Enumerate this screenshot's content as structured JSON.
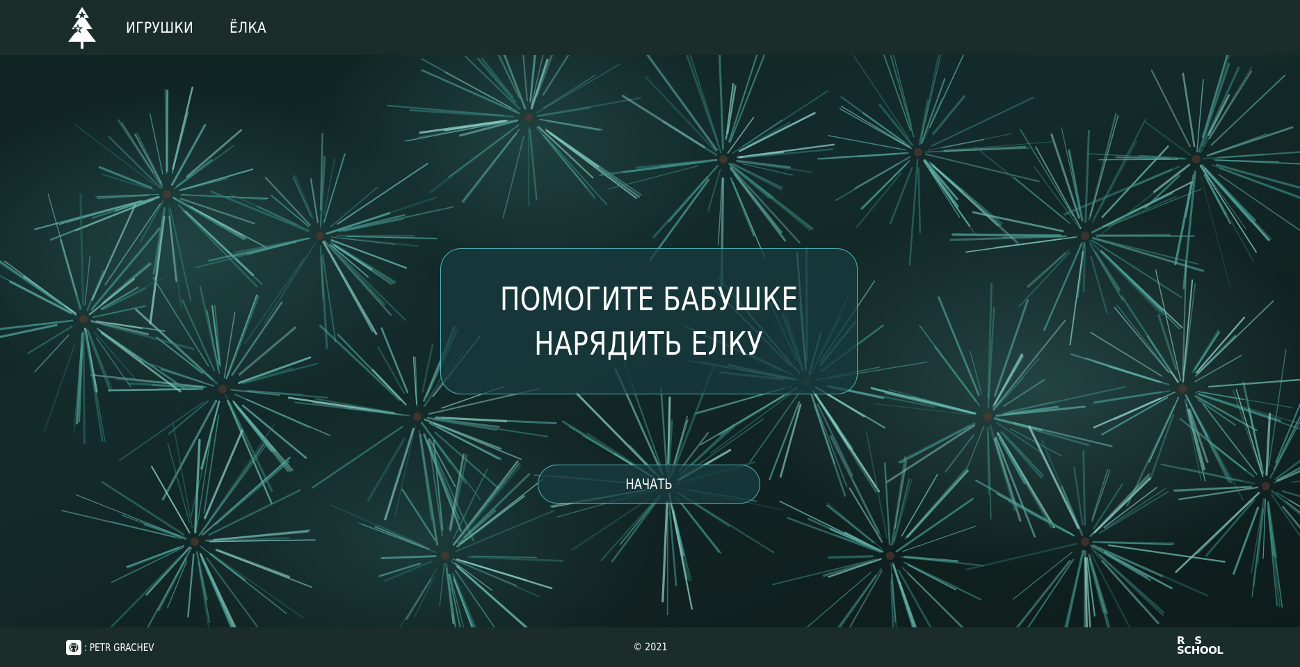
{
  "header": {
    "logo_icon": "christmas-tree-icon",
    "nav": [
      {
        "label": "ИГРУШКИ"
      },
      {
        "label": "ЁЛКА"
      }
    ]
  },
  "hero": {
    "title_lines": [
      "ПОМОГИТЕ БАБУШКЕ",
      "НАРЯДИТЬ ЕЛКУ"
    ],
    "start_label": "НАЧАТЬ",
    "accent_color": "#4fb6c0"
  },
  "footer": {
    "github_icon": "github-icon",
    "github_text": ": PETR GRACHEV",
    "copyright": "© 2021",
    "school_logo_rows": [
      "R   S",
      "SCHOOL"
    ]
  },
  "colors": {
    "bar_background": "#1a2d2b",
    "text": "#ffffff"
  }
}
